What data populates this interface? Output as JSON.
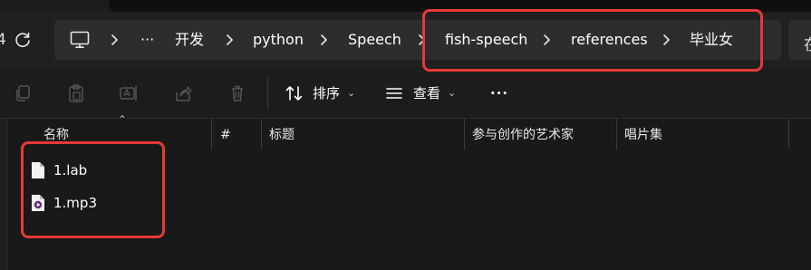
{
  "address_bar": {
    "left_cut_text": "4",
    "right_cut_text": "在",
    "breadcrumbs": [
      "···",
      "开发",
      "python",
      "Speech",
      "fish-speech",
      "references",
      "毕业女"
    ]
  },
  "toolbar": {
    "sort_label": "排序",
    "view_label": "查看",
    "more_label": "···"
  },
  "columns": [
    "名称",
    "#",
    "标题",
    "参与创作的艺术家",
    "唱片集"
  ],
  "files": [
    {
      "name": "1.lab",
      "icon": "text-file-icon"
    },
    {
      "name": "1.mp3",
      "icon": "audio-file-icon"
    }
  ],
  "colors": {
    "annotation": "#e53935",
    "background": "#191919"
  }
}
